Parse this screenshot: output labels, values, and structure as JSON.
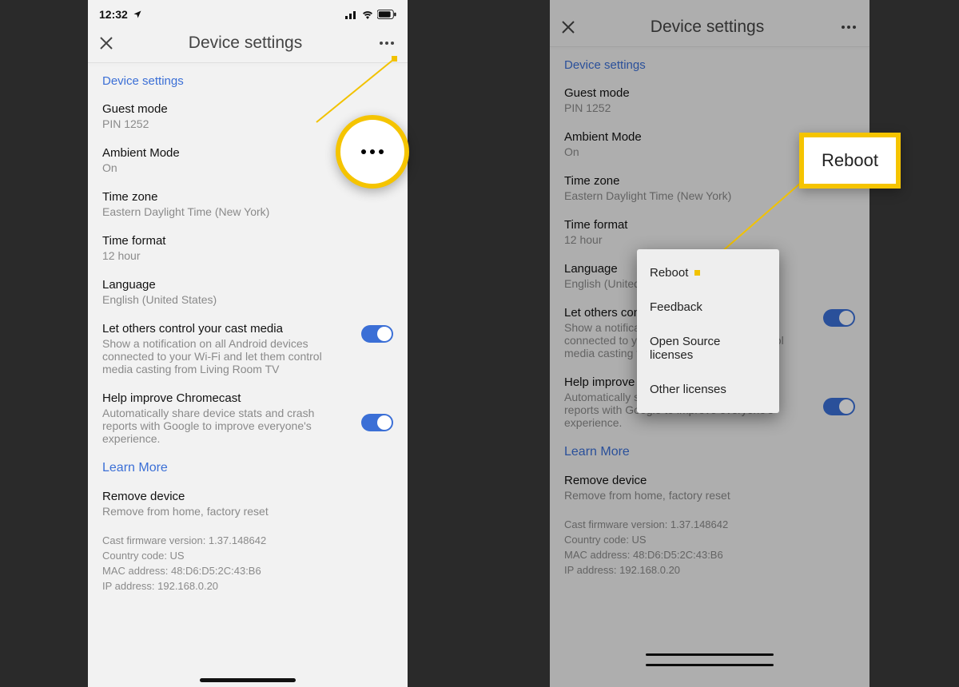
{
  "status": {
    "time": "12:32"
  },
  "header": {
    "title": "Device settings"
  },
  "section_head": "Device settings",
  "rows": {
    "guest": {
      "title": "Guest mode",
      "sub": "PIN 1252"
    },
    "ambient": {
      "title": "Ambient Mode",
      "sub": "On"
    },
    "tz": {
      "title": "Time zone",
      "sub": "Eastern Daylight Time (New York)"
    },
    "tfmt": {
      "title": "Time format",
      "sub": "12 hour"
    },
    "lang": {
      "title": "Language",
      "sub": "English (United States)"
    },
    "cast": {
      "title": "Let others control your cast media",
      "sub": "Show a notification on all Android devices connected to your Wi-Fi and let them control media casting from Living Room TV"
    },
    "cast_r": {
      "sub": "Show a notification on all Android devices connected to your Wi-Fi and let them control media casting from Living Room TV"
    },
    "help": {
      "title": "Help improve Chromecast",
      "sub": "Automatically share device stats and crash reports with Google to improve everyone's experience."
    },
    "remove": {
      "title": "Remove device",
      "sub": "Remove from home, factory reset"
    }
  },
  "learn_more": "Learn More",
  "footer": {
    "fw": "Cast firmware version: 1.37.148642",
    "cc": "Country code: US",
    "mac": "MAC address: 48:D6:D5:2C:43:B6",
    "ip": "IP address: 192.168.0.20"
  },
  "popover": {
    "reboot": "Reboot",
    "feedback": "Feedback",
    "osl": "Open Source licenses",
    "other": "Other licenses"
  },
  "callout": {
    "reboot": "Reboot"
  },
  "colors": {
    "accent": "#3b6fd6",
    "highlight": "#f5c400"
  }
}
